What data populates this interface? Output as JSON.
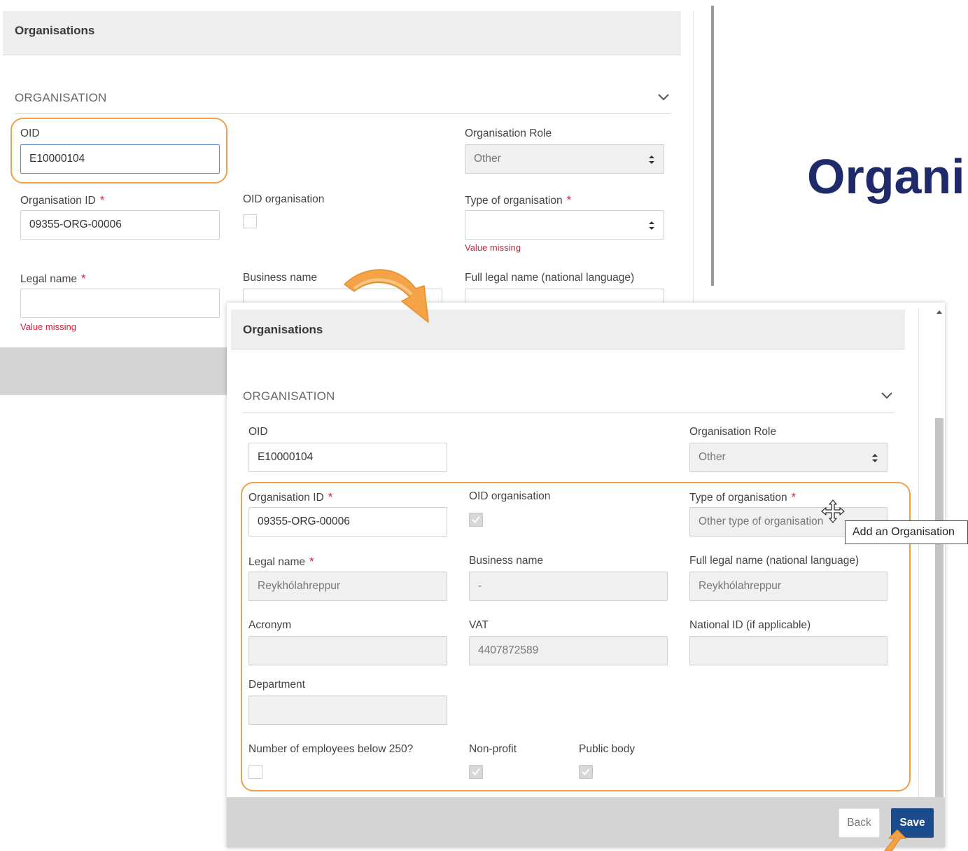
{
  "back_panel": {
    "title": "Organisations",
    "section": "ORGANISATION",
    "oid": {
      "label": "OID",
      "value": "E10000104"
    },
    "organisation_role": {
      "label": "Organisation Role",
      "value": "Other"
    },
    "organisation_id": {
      "label": "Organisation ID",
      "value": "09355-ORG-00006"
    },
    "oid_organisation": {
      "label": "OID organisation",
      "checked": false
    },
    "type_of_organisation": {
      "label": "Type of organisation",
      "value": "",
      "error": "Value missing"
    },
    "legal_name": {
      "label": "Legal name",
      "value": "",
      "error": "Value missing"
    },
    "business_name": {
      "label": "Business name"
    },
    "full_legal_name": {
      "label": "Full legal name (national language)"
    },
    "required_mark": "*"
  },
  "front_panel": {
    "title": "Organisations",
    "section": "ORGANISATION",
    "oid": {
      "label": "OID",
      "value": "E10000104"
    },
    "organisation_role": {
      "label": "Organisation Role",
      "value": "Other"
    },
    "organisation_id": {
      "label": "Organisation ID",
      "value": "09355-ORG-00006"
    },
    "oid_organisation": {
      "label": "OID organisation",
      "checked": true
    },
    "type_of_organisation": {
      "label": "Type of organisation",
      "value": "Other type of organisation"
    },
    "legal_name": {
      "label": "Legal name",
      "value": "Reykhólahreppur"
    },
    "business_name": {
      "label": "Business name",
      "value": "-"
    },
    "full_legal_name": {
      "label": "Full legal name (national language)",
      "value": "Reykhólahreppur"
    },
    "acronym": {
      "label": "Acronym",
      "value": ""
    },
    "vat": {
      "label": "VAT",
      "value": "4407872589"
    },
    "national_id": {
      "label": "National ID (if applicable)",
      "value": ""
    },
    "department": {
      "label": "Department",
      "value": ""
    },
    "employees_below_250": {
      "label": "Number of employees below 250?",
      "checked": false
    },
    "non_profit": {
      "label": "Non-profit",
      "checked": true
    },
    "public_body": {
      "label": "Public body",
      "checked": true
    },
    "required_mark": "*",
    "back_button": "Back",
    "save_button": "Save"
  },
  "tooltip": "Add an Organisation",
  "heading": "Organi",
  "colors": {
    "highlight": "#f0a04b",
    "heading": "#1f2a6b",
    "save": "#1a4b8c",
    "error": "#d0273e"
  },
  "icons": [
    "chevron-down-icon",
    "select-arrows-icon",
    "checkmark-icon",
    "curved-arrow-icon",
    "move-cursor-icon",
    "pointer-arrow-icon"
  ]
}
